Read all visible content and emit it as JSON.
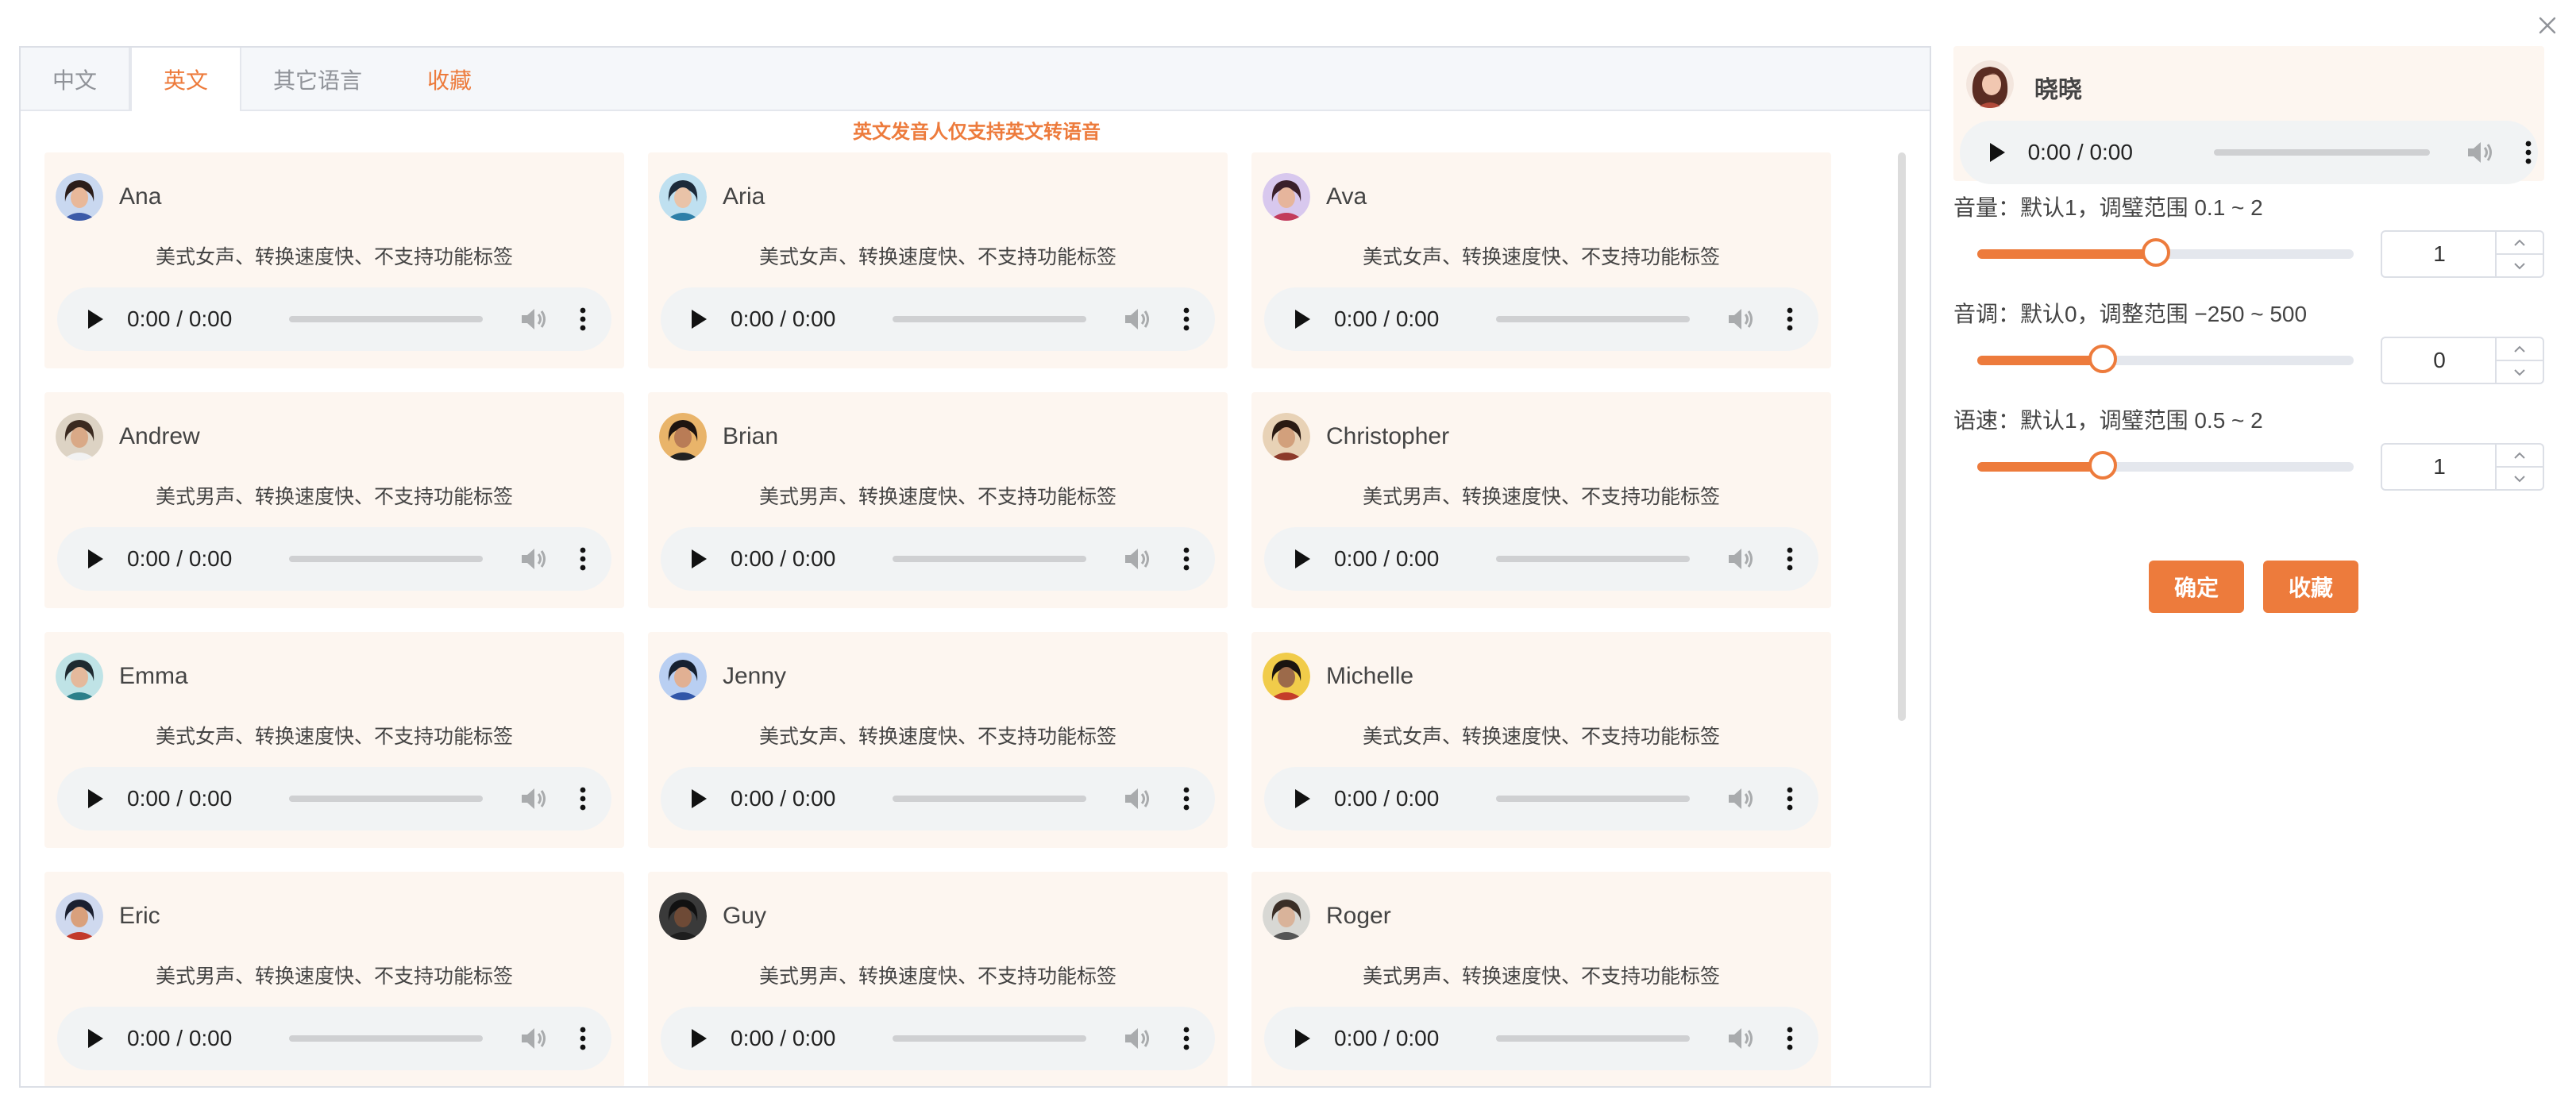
{
  "tabs": [
    {
      "label": "中文"
    },
    {
      "label": "英文"
    },
    {
      "label": "其它语言"
    },
    {
      "label": "收藏"
    }
  ],
  "notice": "英文发音人仅支持英文转语音",
  "player_time": "0:00 / 0:00",
  "cards": [
    {
      "name": "Ana",
      "desc": "美式女声、转换速度快、不支持功能标签"
    },
    {
      "name": "Aria",
      "desc": "美式女声、转换速度快、不支持功能标签"
    },
    {
      "name": "Ava",
      "desc": "美式女声、转换速度快、不支持功能标签"
    },
    {
      "name": "Andrew",
      "desc": "美式男声、转换速度快、不支持功能标签"
    },
    {
      "name": "Brian",
      "desc": "美式男声、转换速度快、不支持功能标签"
    },
    {
      "name": "Christopher",
      "desc": "美式男声、转换速度快、不支持功能标签"
    },
    {
      "name": "Emma",
      "desc": "美式女声、转换速度快、不支持功能标签"
    },
    {
      "name": "Jenny",
      "desc": "美式女声、转换速度快、不支持功能标签"
    },
    {
      "name": "Michelle",
      "desc": "美式女声、转换速度快、不支持功能标签"
    },
    {
      "name": "Eric",
      "desc": "美式男声、转换速度快、不支持功能标签"
    },
    {
      "name": "Guy",
      "desc": "美式男声、转换速度快、不支持功能标签"
    },
    {
      "name": "Roger",
      "desc": "美式男声、转换速度快、不支持功能标签"
    }
  ],
  "selected_voice": {
    "name": "晓晓",
    "time": "0:00 / 0:00"
  },
  "params": {
    "volume": {
      "label": "音量：默认1，调璧范围 0.1 ~ 2",
      "value": "1",
      "min": 0.1,
      "max": 2,
      "current": 1
    },
    "pitch": {
      "label": "音调：默认0，调整范围 −250 ~ 500",
      "value": "0",
      "min": -250,
      "max": 500,
      "current": 0
    },
    "speed": {
      "label": "语速：默认1，调璧范围 0.5 ~ 2",
      "value": "1",
      "min": 0.5,
      "max": 2,
      "current": 1
    }
  },
  "buttons": {
    "confirm": "确定",
    "favorite": "收藏"
  },
  "colors": {
    "accent": "#ed7b3c",
    "card_bg": "#fdf6f0",
    "player_bg": "#f1f3f4"
  },
  "icons": {
    "close": "close-icon",
    "play": "play-icon",
    "volume": "volume-icon",
    "more": "more-vertical-icon"
  }
}
